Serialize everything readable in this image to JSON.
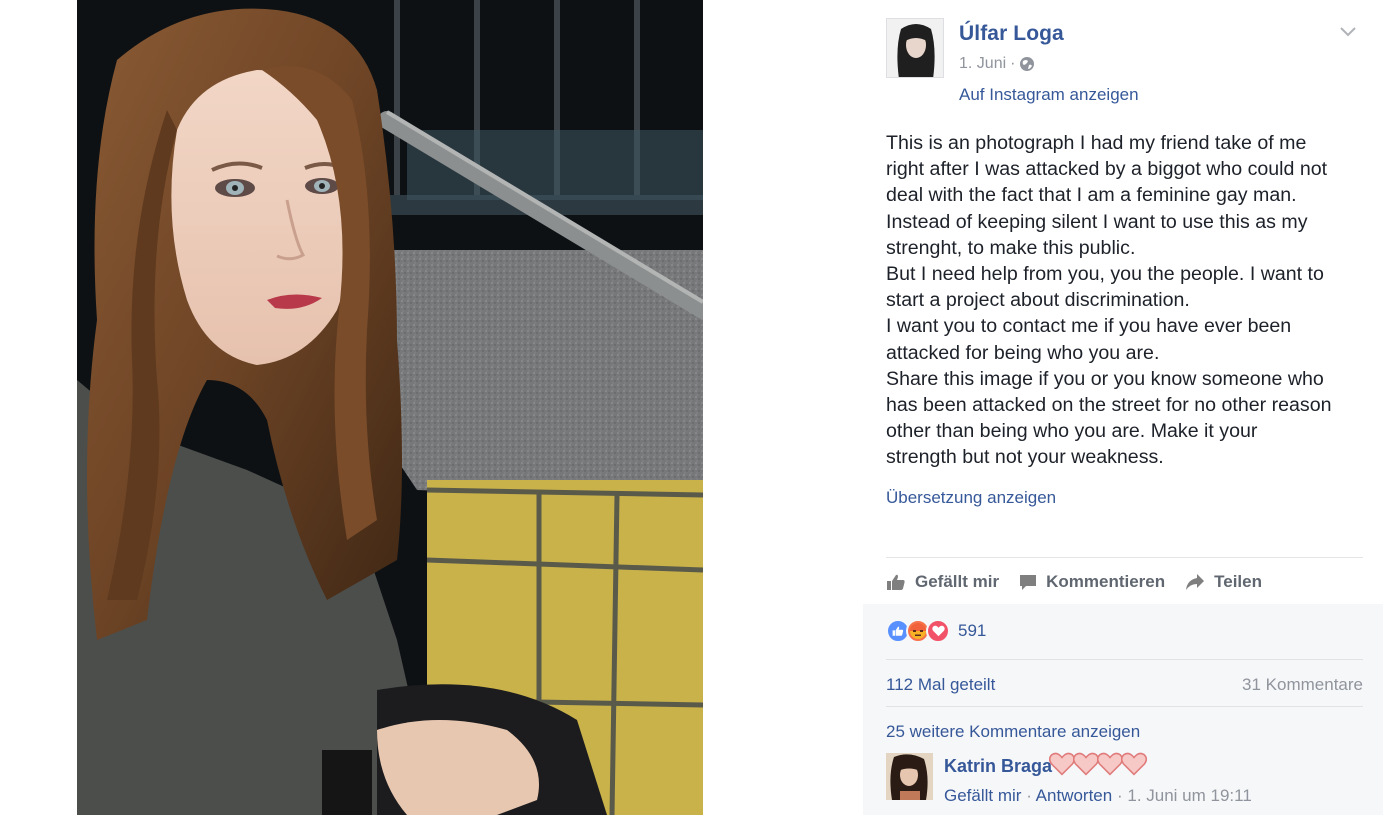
{
  "post": {
    "author": "Úlfar Loga",
    "date": "1. Juni",
    "meta_separator": "·",
    "privacy_icon": "globe-icon",
    "instagram_link": "Auf Instagram anzeigen",
    "text_lines": [
      "This is an photograph I had my friend take of me",
      "right after I was attacked by a biggot who could not",
      "deal with the fact that I am a feminine gay man.",
      "Instead of keeping silent I want to use this as my",
      "strenght, to make this public.",
      "But I need help from you, you the people. I want to",
      "start a project about discrimination.",
      "I want you to contact me if you have ever been",
      "attacked for being who you are.",
      "Share this image if you or you know someone who",
      "has been attacked on the street for no other reason",
      "other than being who you are. Make it your",
      "strength but not your weakness."
    ],
    "translate_link": "Übersetzung anzeigen"
  },
  "actions": {
    "like": "Gefällt mir",
    "comment": "Kommentieren",
    "share": "Teilen"
  },
  "reactions": {
    "icons": [
      "like-reaction-icon",
      "angry-reaction-icon",
      "love-reaction-icon"
    ],
    "count": "591",
    "shares": "112 Mal geteilt",
    "comments": "31 Kommentare",
    "more_comments": "25 weitere Kommentare anzeigen"
  },
  "comment": {
    "author": "Katrin Braga",
    "hearts_count": 4,
    "like_link": "Gefällt mir",
    "separator": "·",
    "reply_link": "Antworten",
    "time": "1. Juni um 19:11"
  },
  "colors": {
    "link": "#365899",
    "muted": "#90949c",
    "text": "#1d2129",
    "like_blue": "#5890ff",
    "angry_orange": "#f7714c",
    "love_red": "#f25268"
  }
}
